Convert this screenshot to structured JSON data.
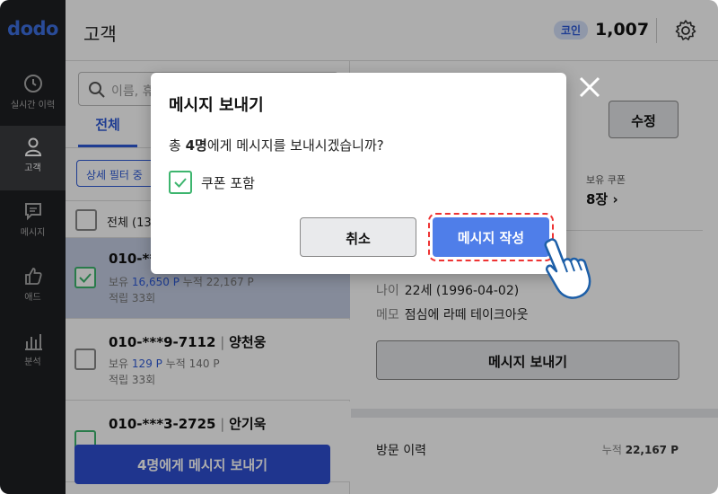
{
  "sidebar": {
    "logo": "dodo",
    "items": [
      {
        "label": "실시간 이력",
        "icon": "clock-icon"
      },
      {
        "label": "고객",
        "icon": "person-icon",
        "active": true
      },
      {
        "label": "메시지",
        "icon": "message-icon"
      },
      {
        "label": "애드",
        "icon": "thumbs-up-icon"
      },
      {
        "label": "분석",
        "icon": "bar-chart-icon"
      }
    ]
  },
  "header": {
    "title": "고객",
    "coin_label": "코인",
    "coin_value": "1,007",
    "settings_icon": "gear-icon"
  },
  "list": {
    "search_placeholder": "이름, 휴",
    "tab_all": "전체",
    "filter_label": "상세 필터 중",
    "select_all_label": "전체 (13",
    "rows": [
      {
        "phone": "010-**",
        "point_label": "보유",
        "point": "16,650 P",
        "total_label": "누적",
        "total": "22,167 P",
        "visits": "적립 33회",
        "checked": true
      },
      {
        "phone": "010-***9-7112",
        "name": "양천웅",
        "point_label": "보유",
        "point": "129 P",
        "total_label": "누적",
        "total": "140 P",
        "visits": "적립 33회",
        "checked": false
      },
      {
        "phone": "010-***3-2725",
        "name": "안기욱",
        "checked": true
      }
    ],
    "send_button": "4명에게 메시지 보내기"
  },
  "detail": {
    "edit_button": "수정",
    "coupon_label": "보유 쿠폰",
    "coupon_value": "8장",
    "age_key": "나이",
    "age_value": "22세 (1996-04-02)",
    "memo_key": "메모",
    "memo_value": "점심에 라떼 테이크아웃",
    "send_button": "메시지 보내기",
    "visit_label": "방문 이력",
    "visit_total_label": "누적",
    "visit_total_value": "22,167 P"
  },
  "modal": {
    "title": "메시지 보내기",
    "body_prefix": "총 ",
    "body_count": "4명",
    "body_suffix": "에게 메시지를 보내시겠습니까?",
    "coupon_include": "쿠폰 포함",
    "coupon_checked": true,
    "cancel_button": "취소",
    "compose_button": "메시지 작성"
  },
  "colors": {
    "accent": "#2f5bd8",
    "compose_button": "#4f7ee9",
    "check_green": "#3db56e",
    "sidebar_bg": "#1e1f22",
    "highlight_dash": "#e33333"
  }
}
